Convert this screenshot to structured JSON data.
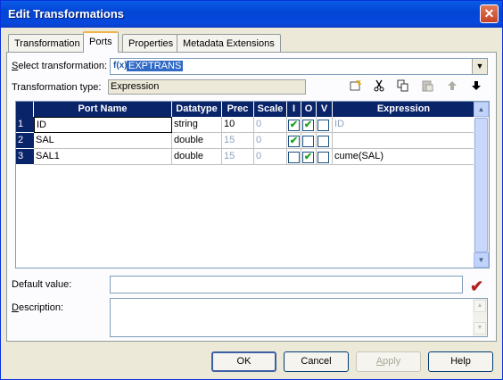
{
  "window": {
    "title": "Edit Transformations",
    "close_label": "✕"
  },
  "tabs": [
    {
      "label": "Transformation"
    },
    {
      "label": "Ports"
    },
    {
      "label": "Properties"
    },
    {
      "label": "Metadata Extensions"
    }
  ],
  "select_transformation": {
    "label_prefix": "",
    "label_accel": "S",
    "label_rest": "elect transformation:",
    "icon": "f(x)",
    "value": "EXPTRANS",
    "dropdown_icon": "▼"
  },
  "transformation_type": {
    "label": "Transformation type:",
    "value": "Expression"
  },
  "toolbar": {
    "new_icon": "new-port-icon",
    "cut_icon": "cut-icon",
    "copy_icon": "copy-icon",
    "paste_icon": "paste-icon",
    "up_icon": "move-up-icon",
    "down_icon": "move-down-icon"
  },
  "grid": {
    "columns": [
      "Port Name",
      "Datatype",
      "Prec",
      "Scale",
      "I",
      "O",
      "V",
      "Expression"
    ],
    "rows": [
      {
        "num": "1",
        "name": "ID",
        "datatype": "string",
        "prec": "10",
        "scale": "0",
        "i": true,
        "o": true,
        "v": false,
        "expression": "ID"
      },
      {
        "num": "2",
        "name": "SAL",
        "datatype": "double",
        "prec": "15",
        "scale": "0",
        "i": true,
        "o": false,
        "v": false,
        "expression": ""
      },
      {
        "num": "3",
        "name": "SAL1",
        "datatype": "double",
        "prec": "15",
        "scale": "0",
        "i": false,
        "o": true,
        "v": false,
        "expression": "cume(SAL)"
      }
    ]
  },
  "default_value": {
    "label_accel": "",
    "label": "Default value:",
    "value": ""
  },
  "description": {
    "label_accel": "D",
    "label_rest": "escription:",
    "value": ""
  },
  "buttons": {
    "ok": "OK",
    "cancel": "Cancel",
    "apply_accel": "A",
    "apply_rest": "pply",
    "help": "Help"
  },
  "colors": {
    "title_bar": "#0a5ce8",
    "grid_header": "#0a246a",
    "selection": "#316ac5",
    "check_green": "#21a121",
    "validate_mark": "#b32121"
  }
}
